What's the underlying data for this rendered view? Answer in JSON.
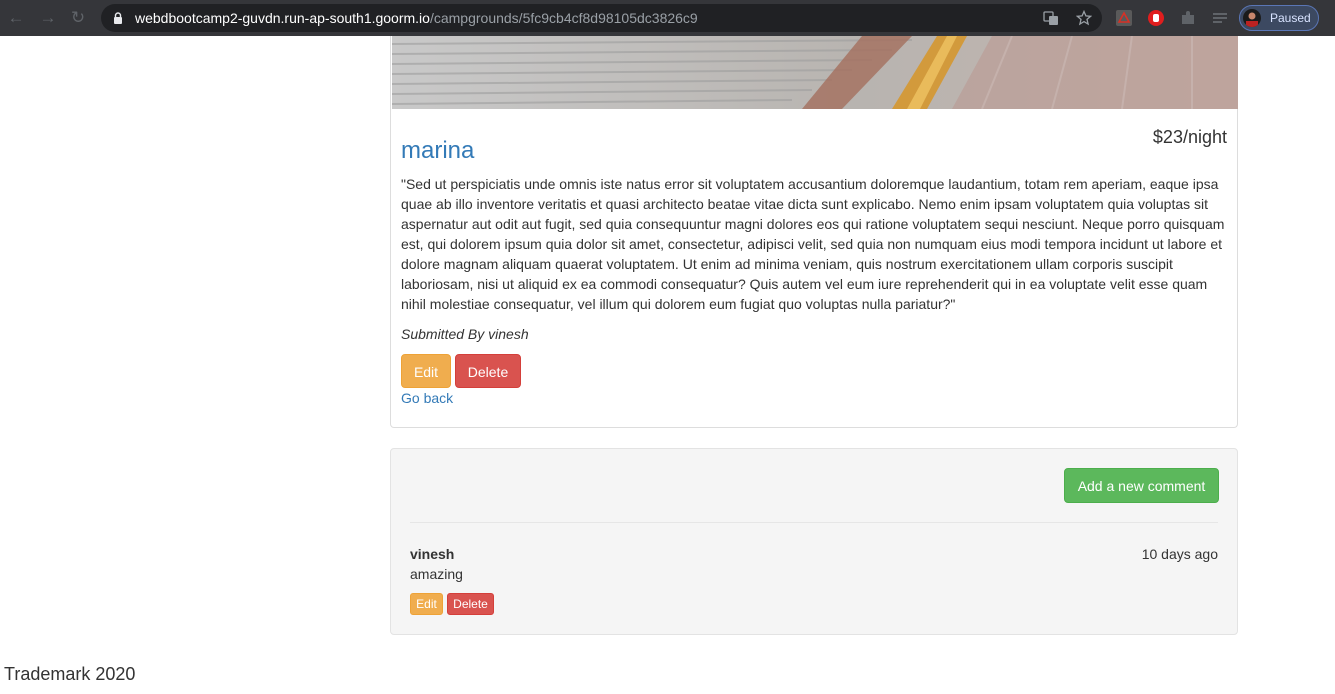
{
  "browser": {
    "url_host": "webdbootcamp2-guvdn.run-ap-south1.goorm.io",
    "url_path": "/campgrounds/5fc9cb4cf8d98105dc3826c9",
    "profile_status": "Paused",
    "icons": [
      "back-icon",
      "forward-icon",
      "reload-icon",
      "lock-icon",
      "translate-icon",
      "star-icon",
      "pdf-extension-icon",
      "hand-extension-icon",
      "puzzle-extension-icon",
      "reading-list-icon",
      "avatar"
    ]
  },
  "campground": {
    "name": "marina",
    "price": "$23/night",
    "description": "\"Sed ut perspiciatis unde omnis iste natus error sit voluptatem accusantium doloremque laudantium, totam rem aperiam, eaque ipsa quae ab illo inventore veritatis et quasi architecto beatae vitae dicta sunt explicabo. Nemo enim ipsam voluptatem quia voluptas sit aspernatur aut odit aut fugit, sed quia consequuntur magni dolores eos qui ratione voluptatem sequi nesciunt. Neque porro quisquam est, qui dolorem ipsum quia dolor sit amet, consectetur, adipisci velit, sed quia non numquam eius modi tempora incidunt ut labore et dolore magnam aliquam quaerat voluptatem. Ut enim ad minima veniam, quis nostrum exercitationem ullam corporis suscipit laboriosam, nisi ut aliquid ex ea commodi consequatur? Quis autem vel eum iure reprehenderit qui in ea voluptate velit esse quam nihil molestiae consequatur, vel illum qui dolorem eum fugiat quo voluptas nulla pariatur?\"",
    "submitted_by": "Submitted By vinesh",
    "edit_label": "Edit",
    "delete_label": "Delete",
    "go_back_label": "Go back"
  },
  "comments_section": {
    "add_comment_label": "Add a new comment",
    "comments": [
      {
        "author": "vinesh",
        "time": "10 days ago",
        "text": "amazing",
        "edit_label": "Edit",
        "delete_label": "Delete"
      }
    ]
  },
  "footer": {
    "text": "Trademark 2020"
  },
  "colors": {
    "link": "#337ab7",
    "warning": "#f0ad4e",
    "danger": "#d9534f",
    "success": "#5cb85c",
    "well": "#f5f5f5"
  }
}
